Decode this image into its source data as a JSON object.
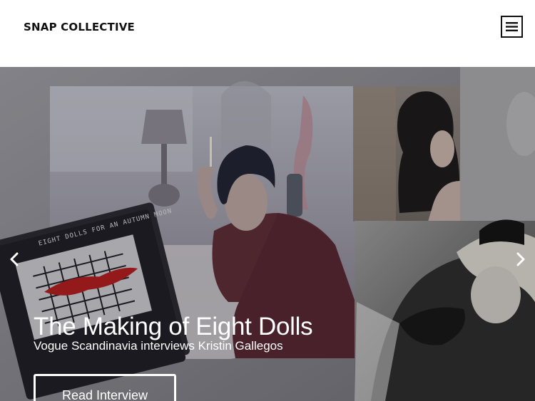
{
  "header": {
    "brand": "SNAP COLLECTIVE",
    "menu_icon": "hamburger-menu-icon"
  },
  "hero": {
    "title": "The Making of Eight Dolls",
    "subtitle": "Vogue Scandinavia interviews Kristin Gallegos",
    "cta_label": "Read Interview",
    "book_cover_text": "EIGHT DOLLS FOR AN AUTUMN MOON",
    "prev_icon": "chevron-left-icon",
    "next_icon": "chevron-right-icon"
  }
}
